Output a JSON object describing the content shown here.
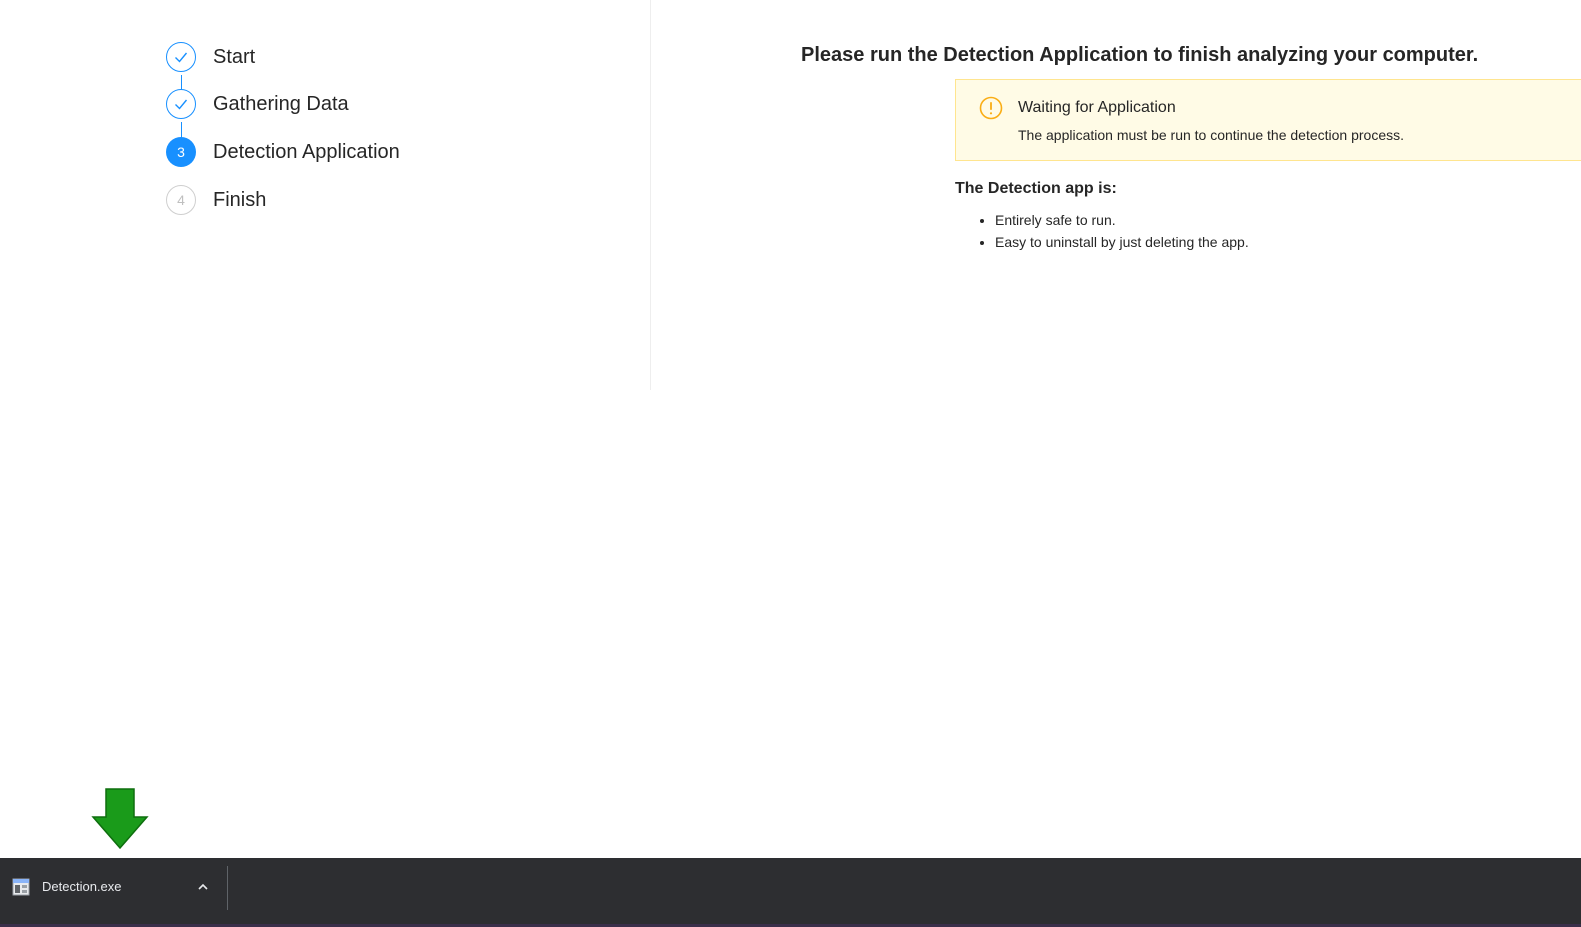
{
  "steps": [
    {
      "number": "1",
      "label": "Start",
      "status": "done"
    },
    {
      "number": "2",
      "label": "Gathering Data",
      "status": "done"
    },
    {
      "number": "3",
      "label": "Detection Application",
      "status": "active"
    },
    {
      "number": "4",
      "label": "Finish",
      "status": "wait"
    }
  ],
  "main": {
    "title": "Please run the Detection Application to finish analyzing your computer.",
    "alert": {
      "icon": "exclamation-circle-icon",
      "title": "Waiting for Application",
      "description": "The application must be run to continue the detection process."
    },
    "info_heading": "The Detection app is:",
    "info_items": [
      "Entirely safe to run.",
      "Easy to uninstall by just deleting the app."
    ]
  },
  "download_bar": {
    "file_name": "Detection.exe",
    "file_icon": "executable-file-icon",
    "menu_icon": "chevron-up-icon"
  },
  "colors": {
    "accent": "#1890ff",
    "warning": "#faad14",
    "alert_bg": "#fffbe6",
    "arrow": "#1a9b1a",
    "download_bar_bg": "#2d2e31"
  }
}
